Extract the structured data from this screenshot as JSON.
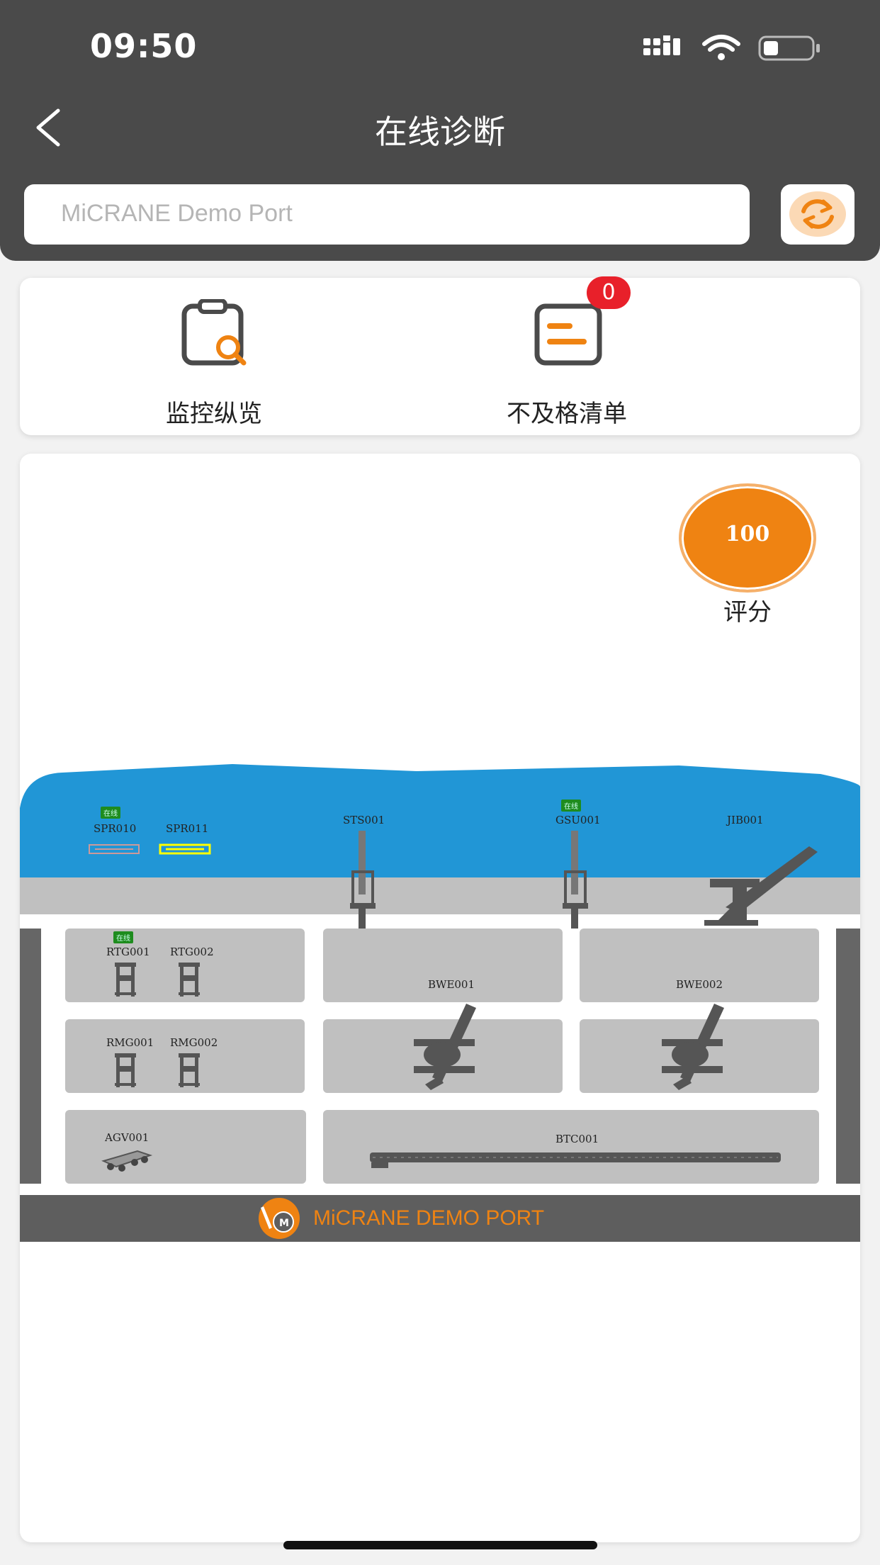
{
  "status_bar": {
    "time": "09:50"
  },
  "header": {
    "title": "在线诊断"
  },
  "search": {
    "placeholder": "MiCRANE Demo Port"
  },
  "quick_actions": [
    {
      "label": "监控纵览"
    },
    {
      "label": "不及格清单",
      "badge": "0"
    }
  ],
  "score": {
    "value": "100",
    "label": "评分"
  },
  "port_map": {
    "online_tag": "在线",
    "equipment": {
      "spr010": "SPR010",
      "spr011": "SPR011",
      "sts001": "STS001",
      "gsu001": "GSU001",
      "jib001": "JIB001",
      "rtg001": "RTG001",
      "rtg002": "RTG002",
      "bwe001": "BWE001",
      "bwe002": "BWE002",
      "rmg001": "RMG001",
      "rmg002": "RMG002",
      "agv001": "AGV001",
      "btc001": "BTC001"
    },
    "banner": "MiCRANE DEMO PORT"
  },
  "colors": {
    "accent": "#ef8312",
    "header_bg": "#4a4a4a",
    "badge": "#e8202a",
    "sea": "#2196d6",
    "online": "#1e8c1e"
  }
}
